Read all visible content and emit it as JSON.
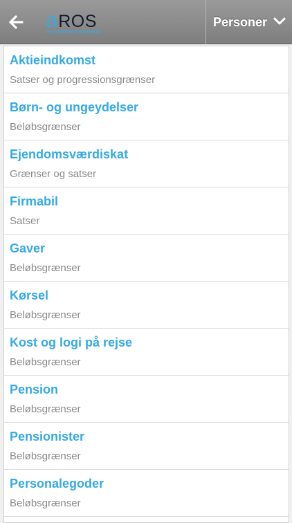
{
  "header": {
    "logo": {
      "a": "a",
      "ros": "ROS"
    },
    "menu_label": "Personer",
    "back_icon": "arrow-left-icon",
    "menu_icon": "chevron-down-icon"
  },
  "colors": {
    "accent": "#36a9e4",
    "subtitle": "#8a8a8a",
    "header": "#8c8c8c"
  },
  "items": [
    {
      "title": "Aktieindkomst",
      "subtitle": "Satser og progressionsgrænser"
    },
    {
      "title": "Børn- og ungeydelser",
      "subtitle": "Beløbsgrænser"
    },
    {
      "title": "Ejendomsværdiskat",
      "subtitle": "Grænser og satser"
    },
    {
      "title": "Firmabil",
      "subtitle": "Satser"
    },
    {
      "title": "Gaver",
      "subtitle": "Beløbsgrænser"
    },
    {
      "title": "Kørsel",
      "subtitle": "Beløbsgrænser"
    },
    {
      "title": "Kost og logi på rejse",
      "subtitle": "Beløbsgrænser"
    },
    {
      "title": "Pension",
      "subtitle": "Beløbsgrænser"
    },
    {
      "title": "Pensionister",
      "subtitle": "Beløbsgrænser"
    },
    {
      "title": "Personalegoder",
      "subtitle": "Beløbsgrænser"
    }
  ]
}
